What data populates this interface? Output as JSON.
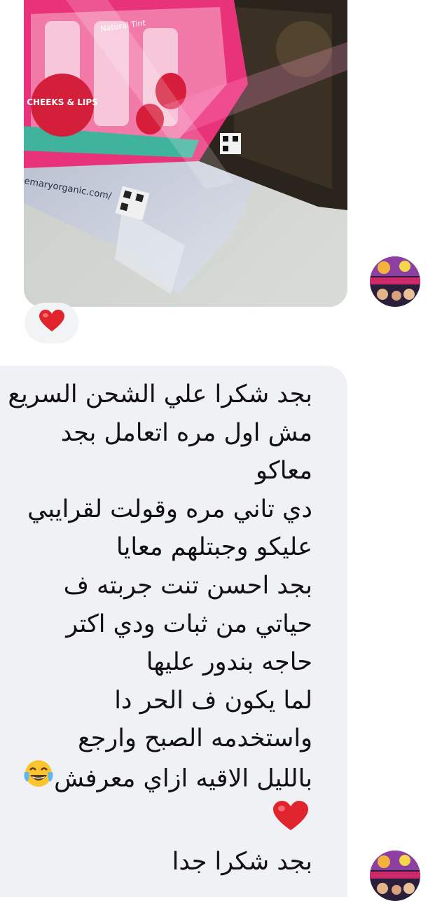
{
  "message": {
    "lines": [
      "بجد شكرا علي الشحن السريع",
      "مش اول مره اتعامل بجد",
      "معاكو",
      "دي تاني مره وقولت لقرايبي",
      "عليكو وجبتلهم معايا",
      "بجد احسن تنت جربته ف",
      "حياتي من ثبات ودي اكتر",
      "حاجه بندور عليها",
      "لما يكون ف الحر دا",
      "واستخدمه الصبح وارجع",
      "بالليل الاقيه ازاي معرفش",
      "",
      "بجد شكرا جدا"
    ],
    "line12_emoji": "tears-of-joy-icon",
    "line13_emoji": "heart-icon"
  },
  "reaction": {
    "emoji": "heart-icon"
  },
  "photo": {
    "box_label": "CHEEKS & LIPS",
    "tint_label": "Natural Tint",
    "url_text": "emaryorganic.com/",
    "colors": {
      "pink": "#e8327a",
      "dark_box": "#2b241c",
      "bag": "#c9ced9"
    }
  },
  "colors": {
    "bubble": "#f0f1f4",
    "heart": "#e0242e",
    "reaction_bg": "#f2f3f5"
  }
}
